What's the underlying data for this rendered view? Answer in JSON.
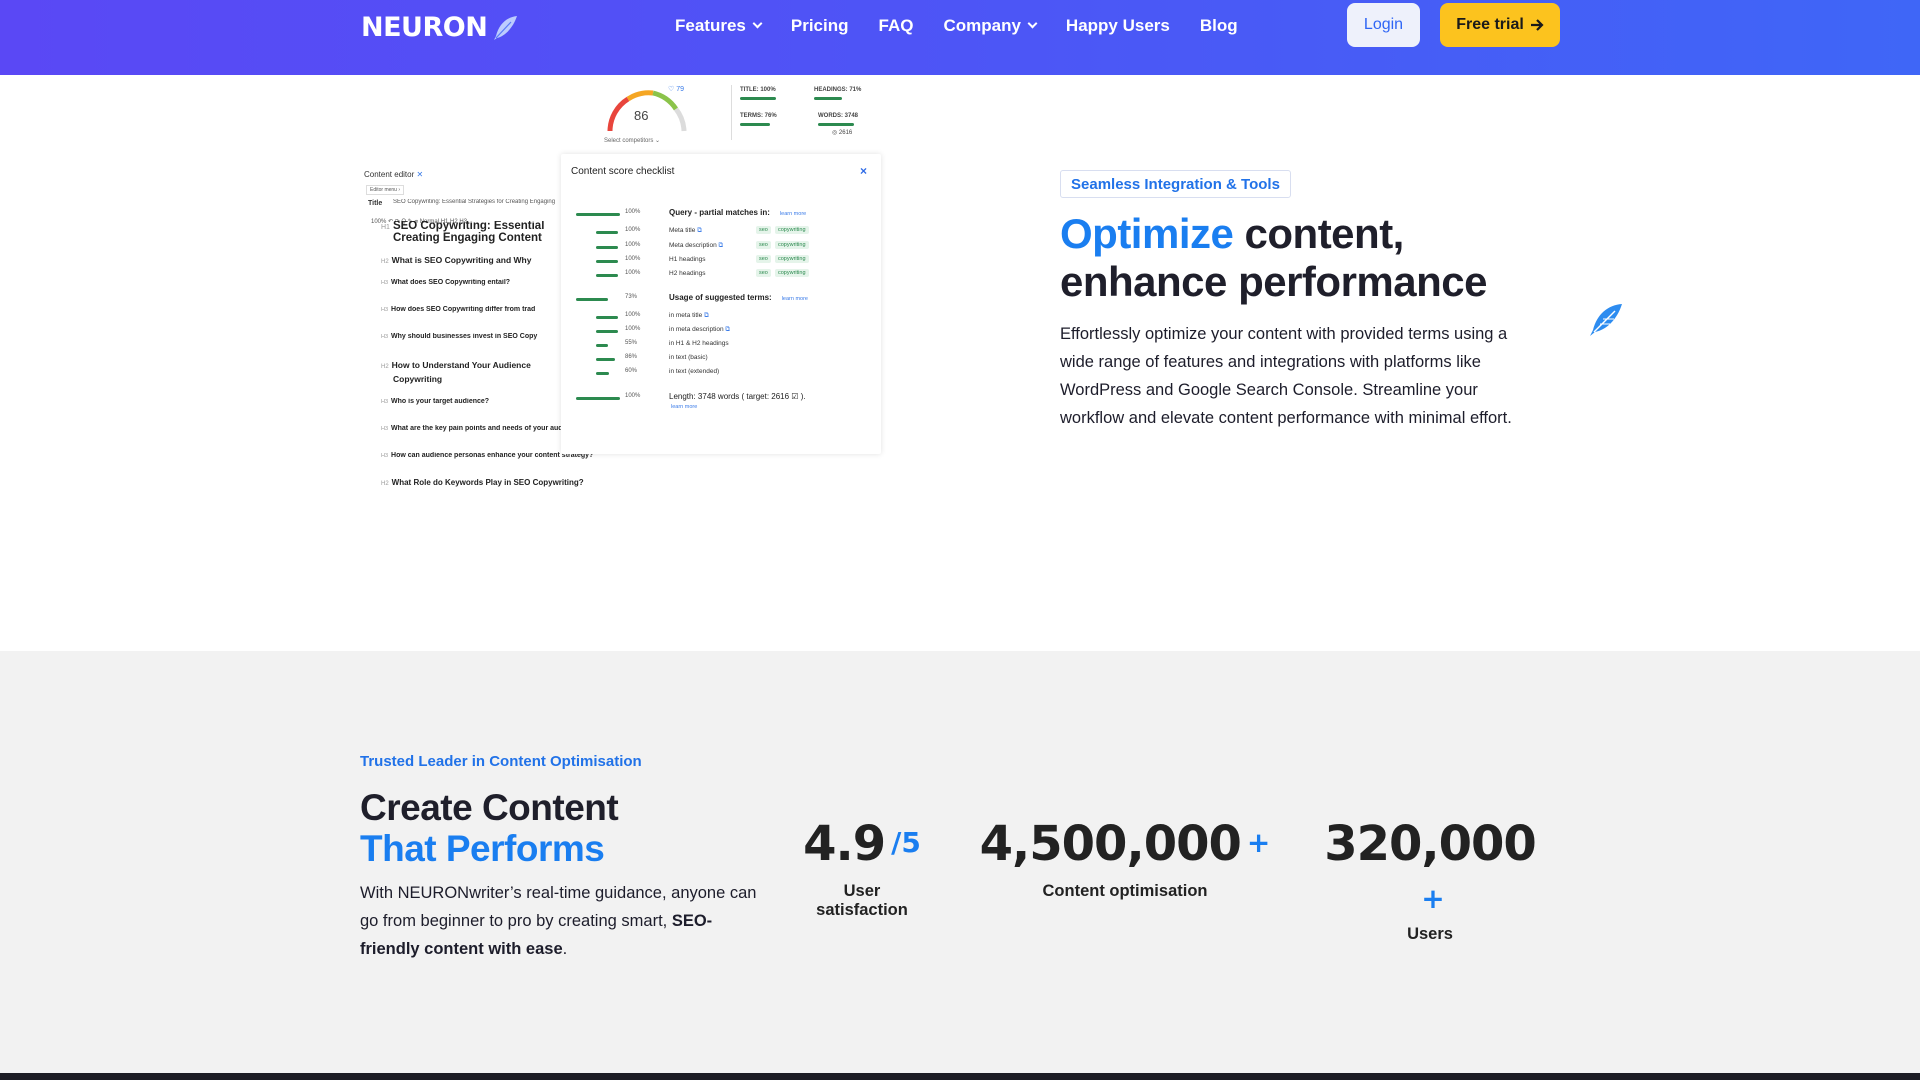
{
  "nav": {
    "logo": "NEURON",
    "links": [
      {
        "label": "Features",
        "dropdown": true
      },
      {
        "label": "Pricing",
        "dropdown": false
      },
      {
        "label": "FAQ",
        "dropdown": false
      },
      {
        "label": "Company",
        "dropdown": true
      },
      {
        "label": "Happy Users",
        "dropdown": false
      },
      {
        "label": "Blog",
        "dropdown": false
      }
    ],
    "login": "Login",
    "trial": "Free trial"
  },
  "mock": {
    "gauge_score": "86",
    "gauge_badge": "79",
    "gauge_sub": "Select competitors",
    "mini_stats": {
      "title": "TITLE: 100%",
      "headings": "HEADINGS: 71%",
      "terms": "TERMS: 76%",
      "words": "WORDS: 3748",
      "words_sub": "2616"
    },
    "editor": {
      "title": "Content editor",
      "menu": "Editor menu",
      "title_label": "Title",
      "title_value": "SEO Copywriting: Essential Strategies for Creating Engaging",
      "toolbar": "100%   ↶ ↷   Q ✎ ⌀   Normal  H1  H2  H3",
      "headings": [
        {
          "level": "H1",
          "text": "SEO Copywriting: Essential",
          "text2": "Creating Engaging Content"
        },
        {
          "level": "H2",
          "text": "What is SEO Copywriting and Why"
        },
        {
          "level": "H3",
          "text": "What does SEO Copywriting entail?"
        },
        {
          "level": "H3",
          "text": "How does SEO Copywriting differ from trad"
        },
        {
          "level": "H3",
          "text": "Why should businesses invest in SEO Copy"
        },
        {
          "level": "H2",
          "text": "How to Understand Your Audience",
          "text2": "Copywriting"
        },
        {
          "level": "H3",
          "text": "Who is your target audience?"
        },
        {
          "level": "H3",
          "text": "What are the key pain points and needs of your audience?"
        },
        {
          "level": "H3",
          "text": "How can audience personas enhance your content strategy?"
        },
        {
          "level": "H2",
          "text": "What Role do Keywords Play in SEO Copywriting?"
        }
      ]
    },
    "checklist": {
      "title": "Content score checklist",
      "close": "×",
      "learn_more": "learn more",
      "sections": [
        {
          "title": "Query - partial matches in:",
          "pct": "100%",
          "fill": 1.0
        },
        {
          "title": "Usage of suggested terms:",
          "pct": "73%",
          "fill": 0.73
        },
        {
          "title": "Length: 3748 words ( target: 2616 ☑ ).",
          "pct": "100%",
          "fill": 1.0
        }
      ],
      "query_rows": [
        {
          "label": "Meta title",
          "pct": "100%",
          "fill": 1.0
        },
        {
          "label": "Meta description",
          "pct": "100%",
          "fill": 1.0
        },
        {
          "label": "H1 headings",
          "pct": "100%",
          "fill": 1.0
        },
        {
          "label": "H2 headings",
          "pct": "100%",
          "fill": 1.0
        }
      ],
      "tags": [
        "seo",
        "copywriting"
      ],
      "term_rows": [
        {
          "label": "in meta title",
          "pct": "100%",
          "fill": 1.0
        },
        {
          "label": "in meta description",
          "pct": "100%",
          "fill": 1.0
        },
        {
          "label": "in H1 & H2 headings",
          "pct": "55%",
          "fill": 0.55
        },
        {
          "label": "in text (basic)",
          "pct": "86%",
          "fill": 0.86
        },
        {
          "label": "in text (extended)",
          "pct": "60%",
          "fill": 0.6
        }
      ]
    }
  },
  "optimize": {
    "badge": "Seamless Integration & Tools",
    "heading_hl": "Optimize",
    "heading_rest": " content,",
    "heading_line2": "enhance performance",
    "body": "Effortlessly optimize your content with provided terms using a wide range of features and integrations with platforms like WordPress and Google Search Console. Streamline your workflow and elevate content performance with minimal effort."
  },
  "trusted": {
    "eyebrow": "Trusted Leader in Content Optimisation",
    "heading1": "Create Content",
    "heading2": "That Performs",
    "body_pre": "With NEURONwriter’s real-time guidance, anyone can go from beginner to pro by creating smart, ",
    "body_bold": "SEO-friendly content with ease",
    "body_post": ".",
    "stats": [
      {
        "value": "4.9",
        "suffix": "/5",
        "label": "User satisfaction"
      },
      {
        "value": "4,500,000",
        "suffix": "+",
        "label": "Content optimisation"
      },
      {
        "value": "320,000",
        "suffix": "+",
        "label": "Users"
      }
    ]
  },
  "colors": {
    "nav_gradient_start": "#5a48f5",
    "nav_gradient_end": "#3f66f7",
    "accent_blue": "#1a7ef0",
    "cta_yellow": "#fcc31e",
    "score_green": "#2c8a4f"
  }
}
